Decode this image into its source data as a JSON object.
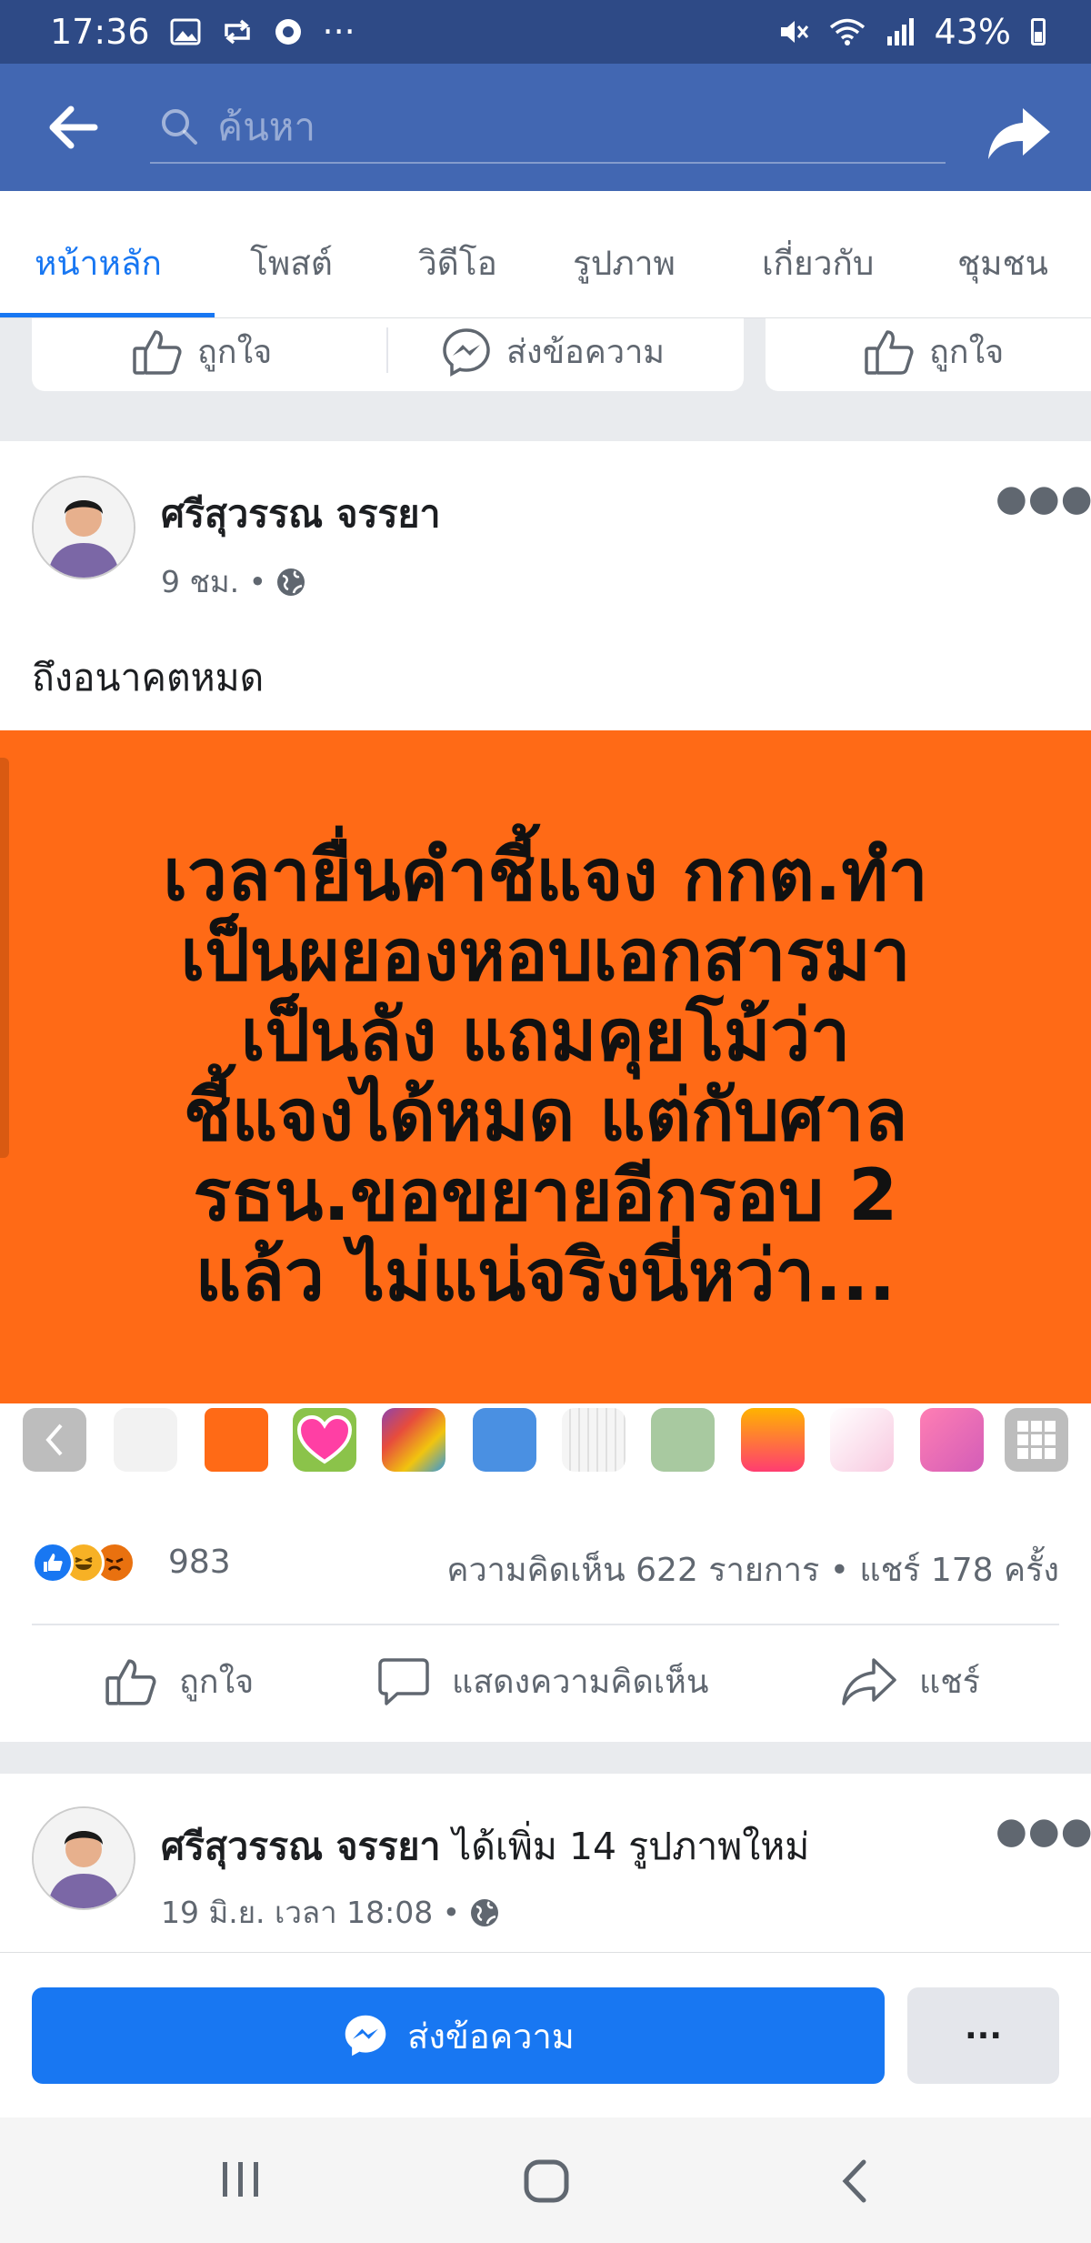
{
  "status_bar": {
    "time": "17:36",
    "more": "···",
    "battery": "43%"
  },
  "search": {
    "placeholder": "ค้นหา"
  },
  "tabs": [
    {
      "label": "หน้าหลัก",
      "active": true
    },
    {
      "label": "โพสต์"
    },
    {
      "label": "วิดีโอ"
    },
    {
      "label": "รูปภาพ"
    },
    {
      "label": "เกี่ยวกับ"
    },
    {
      "label": "ชุมชน"
    }
  ],
  "top_card": {
    "like_label": "ถูกใจ",
    "message_label": "ส่งข้อความ",
    "like2_label": "ถูกใจ"
  },
  "post": {
    "author": "ศรีสุวรรณ จรรยา",
    "time": "9 ชม. •",
    "text": "ถึงอนาคตหมด",
    "image_text": [
      "เวลายื่นคำชี้แจง กกต.ทำ",
      "เป็นผยองหอบเอกสารมา",
      "เป็นลัง แถมคุยโม้ว่า",
      "ชี้แจงได้หมด แต่กับศาล",
      "รธน.ขอขยายอีกรอบ 2",
      "แล้ว ไม่แน่จริงนี่หว่า..."
    ],
    "image_bg": "#ff6a16",
    "reaction_count": "983",
    "comments_shares": "ความคิดเห็น 622 รายการ • แชร์ 178 ครั้ง",
    "actions": {
      "like": "ถูกใจ",
      "comment": "แสดงความคิดเห็น",
      "share": "แชร์"
    }
  },
  "post2": {
    "author": "ศรีสุวรรณ จรรยา",
    "action": " ได้เพิ่ม 14 รูปภาพใหม่",
    "time": "19 มิ.ย. เวลา 18:08 •"
  },
  "bottom": {
    "message_button": "ส่งข้อความ",
    "more_button": "···"
  },
  "colors": {
    "brand": "#4267b2",
    "accent": "#1877f2",
    "status_bar": "#2e4a86"
  }
}
